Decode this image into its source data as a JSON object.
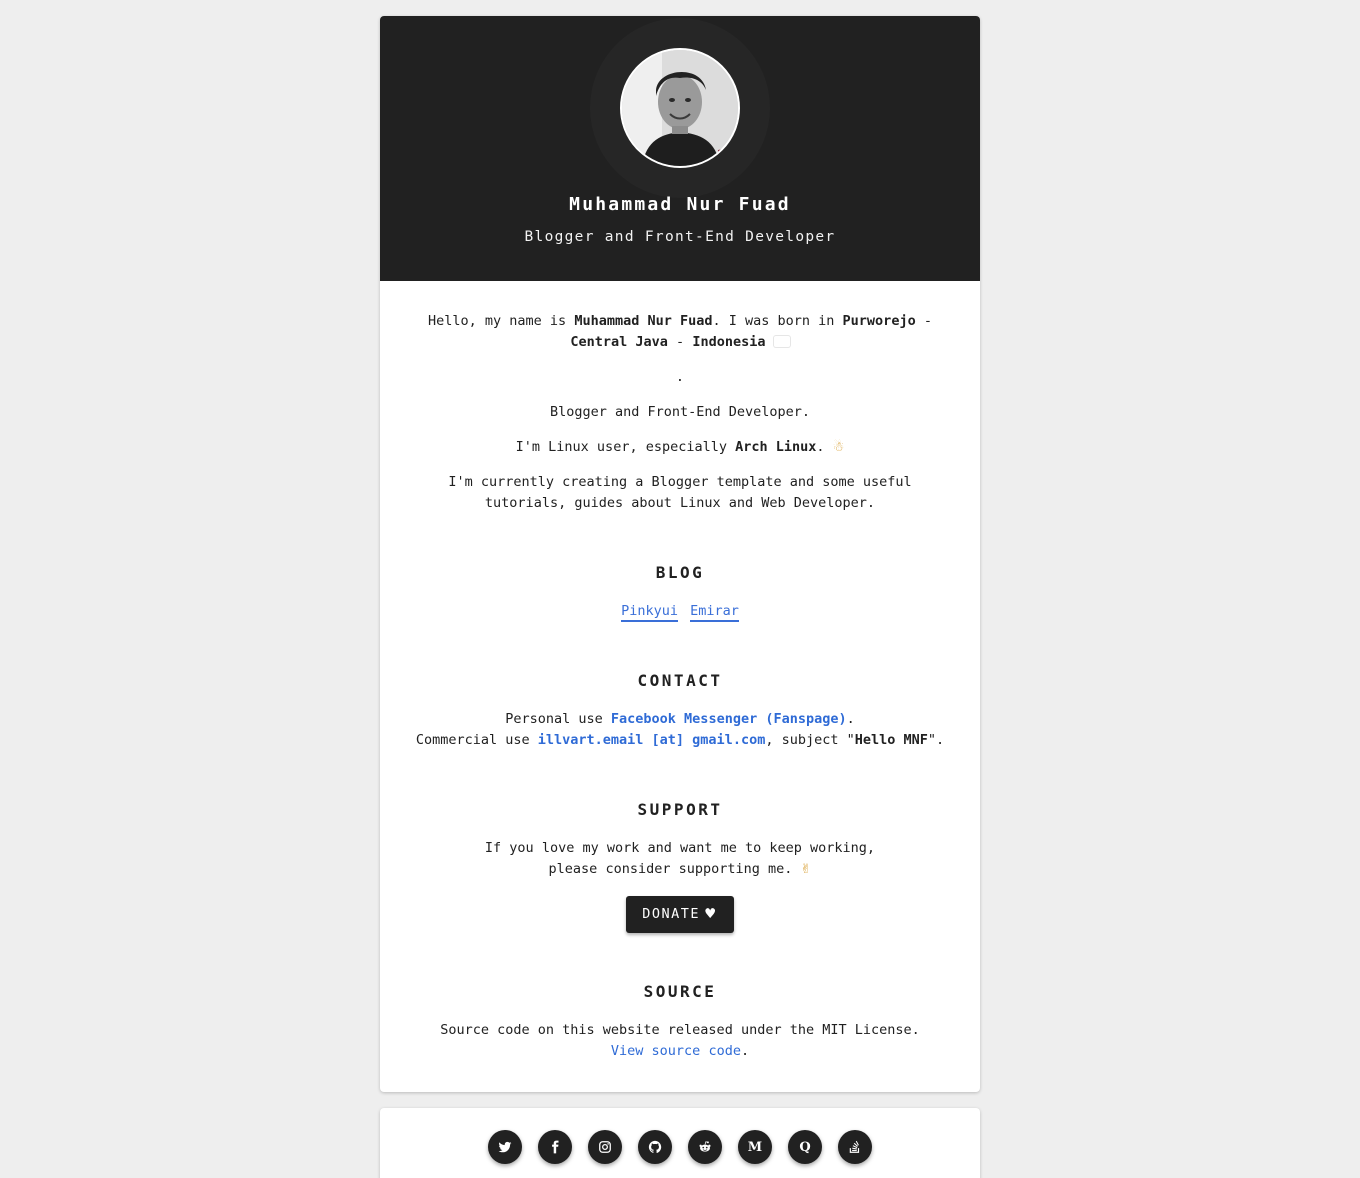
{
  "profile": {
    "name": "Muhammad Nur Fuad",
    "role": "Blogger and Front-End Developer"
  },
  "about": {
    "intro_pre": "Hello, my name is ",
    "intro_name": "Muhammad Nur Fuad",
    "intro_mid": ". I was born in ",
    "intro_place1": "Purworejo",
    "intro_sep": " - ",
    "intro_place2": "Central Java",
    "intro_place3": "Indonesia",
    "intro_end": ".",
    "role_line": "Blogger and Front-End Developer.",
    "linux_pre": "I'm Linux user, especially ",
    "linux_name": "Arch Linux",
    "linux_end": ".",
    "current": "I'm currently creating a Blogger template and some useful tutorials, guides about Linux and Web Developer."
  },
  "blog": {
    "title": "BLOG",
    "links": [
      "Pinkyui",
      "Emirar"
    ]
  },
  "contact": {
    "title": "CONTACT",
    "personal_pre": "Personal use ",
    "personal_link": "Facebook Messenger (Fanspage)",
    "personal_end": ".",
    "commercial_pre": "Commercial use ",
    "commercial_link": "illvart.email [at] gmail.com",
    "commercial_mid": ", subject \"",
    "commercial_subject": "Hello MNF",
    "commercial_end": "\"."
  },
  "support": {
    "title": "SUPPORT",
    "text": "If you love my work and want me to keep working, please consider supporting me.",
    "donate_label": "DONATE",
    "donate_icon": "heart-icon"
  },
  "source": {
    "title": "SOURCE",
    "text": "Source code on this website released under the MIT License.",
    "link": "View source code",
    "link_end": "."
  },
  "social": {
    "icons": [
      "twitter-icon",
      "facebook-icon",
      "instagram-icon",
      "github-icon",
      "reddit-icon",
      "medium-icon",
      "quora-icon",
      "stackoverflow-icon"
    ],
    "medium_letter": "M",
    "quora_letter": "Q"
  },
  "colors": {
    "header_bg": "#212121",
    "page_bg": "#eeeeee",
    "link": "#2f6bd6",
    "button_bg": "#212121"
  }
}
